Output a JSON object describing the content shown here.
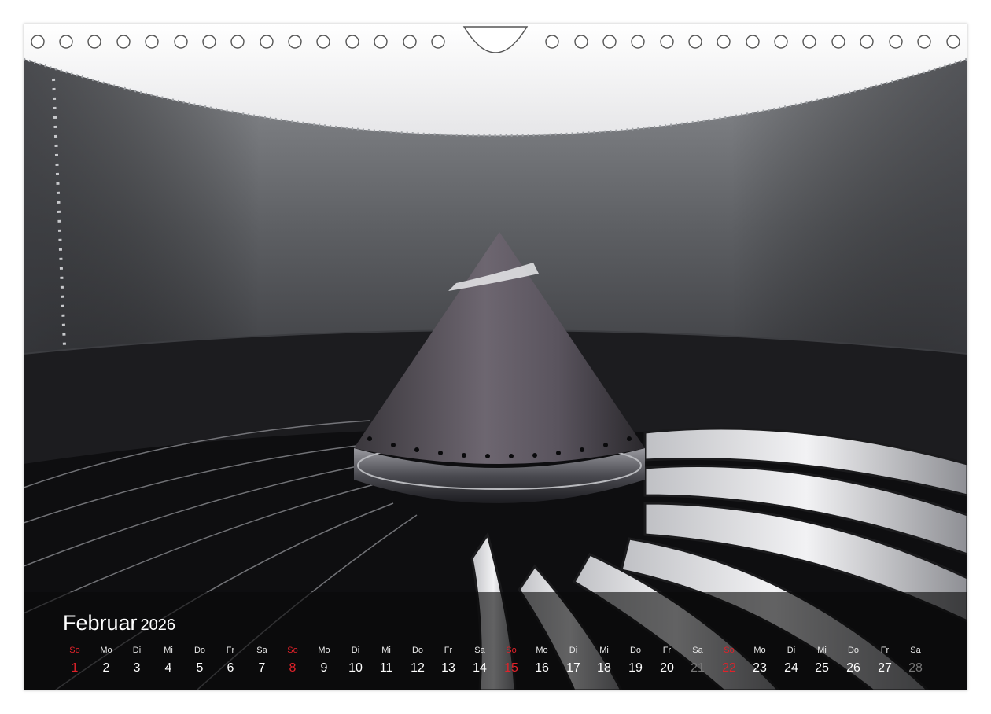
{
  "calendar": {
    "month": "Februar",
    "year": "2026",
    "days": [
      {
        "wd": "So",
        "d": "1"
      },
      {
        "wd": "Mo",
        "d": "2"
      },
      {
        "wd": "Di",
        "d": "3"
      },
      {
        "wd": "Mi",
        "d": "4"
      },
      {
        "wd": "Do",
        "d": "5"
      },
      {
        "wd": "Fr",
        "d": "6"
      },
      {
        "wd": "Sa",
        "d": "7"
      },
      {
        "wd": "So",
        "d": "8"
      },
      {
        "wd": "Mo",
        "d": "9"
      },
      {
        "wd": "Di",
        "d": "10"
      },
      {
        "wd": "Mi",
        "d": "11"
      },
      {
        "wd": "Do",
        "d": "12"
      },
      {
        "wd": "Fr",
        "d": "13"
      },
      {
        "wd": "Sa",
        "d": "14"
      },
      {
        "wd": "So",
        "d": "15"
      },
      {
        "wd": "Mo",
        "d": "16"
      },
      {
        "wd": "Di",
        "d": "17"
      },
      {
        "wd": "Mi",
        "d": "18"
      },
      {
        "wd": "Do",
        "d": "19"
      },
      {
        "wd": "Fr",
        "d": "20"
      },
      {
        "wd": "Sa",
        "d": "21"
      },
      {
        "wd": "So",
        "d": "22"
      },
      {
        "wd": "Mo",
        "d": "23"
      },
      {
        "wd": "Di",
        "d": "24"
      },
      {
        "wd": "Mi",
        "d": "25"
      },
      {
        "wd": "Do",
        "d": "26"
      },
      {
        "wd": "Fr",
        "d": "27"
      },
      {
        "wd": "Sa",
        "d": "28"
      }
    ]
  },
  "colors": {
    "sunday": "#e0222a",
    "overlay": "#0a0a0a"
  }
}
